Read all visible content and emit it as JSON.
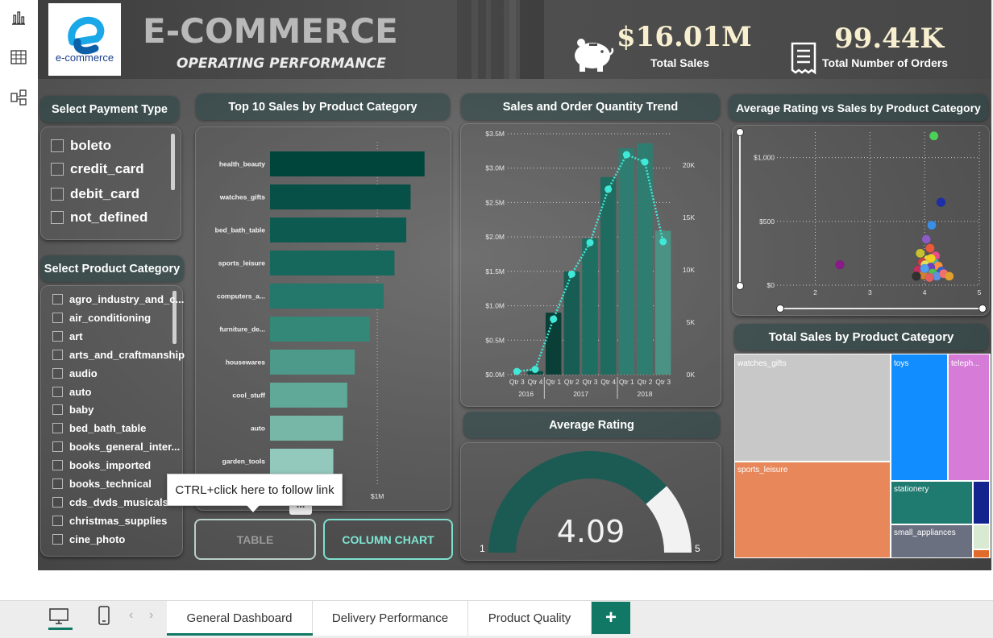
{
  "header": {
    "logo_text": "e-commerce",
    "title": "E-COMMERCE",
    "subtitle": "OPERATING PERFORMANCE",
    "kpis": [
      {
        "value": "$16.01M",
        "label": "Total Sales",
        "icon": "piggy-bank-icon"
      },
      {
        "value": "99.44K",
        "label": "Total Number of Orders",
        "icon": "receipt-icon"
      }
    ]
  },
  "payment_slicer": {
    "title": "Select Payment Type",
    "items": [
      "boleto",
      "credit_card",
      "debit_card",
      "not_defined"
    ]
  },
  "category_slicer": {
    "title": "Select Product Category",
    "items": [
      "agro_industry_and_c...",
      "air_conditioning",
      "art",
      "arts_and_craftmanship",
      "audio",
      "auto",
      "baby",
      "bed_bath_table",
      "books_general_inter...",
      "books_imported",
      "books_technical",
      "cds_dvds_musicals",
      "christmas_supplies",
      "cine_photo"
    ]
  },
  "top10": {
    "title": "Top 10 Sales by Product Category",
    "axis_tick": "$1M",
    "more_glyph": "...",
    "colors": [
      "#00453c",
      "#065047",
      "#0d5a50",
      "#16675c",
      "#24786b",
      "#338878",
      "#4d9a8a",
      "#60a998",
      "#76b7a8",
      "#93c9bd"
    ]
  },
  "trend": {
    "title": "Sales and Order Quantity Trend",
    "years": [
      "2016",
      "2017",
      "2018"
    ],
    "line_color": "#40e8d8",
    "bar_colors": [
      "#0a4c43",
      "#1f6b60",
      "#2f7d70",
      "#4a9284"
    ]
  },
  "scatter": {
    "title": "Average Rating vs Sales by Product Category"
  },
  "gauge": {
    "title": "Average Rating",
    "value": "4.09",
    "min_label": "1",
    "max_label": "5",
    "fraction": 0.7725
  },
  "treemap": {
    "title": "Total Sales by Product Category",
    "tiles": [
      {
        "label": "watches_gifts",
        "color": "#c8c8c8"
      },
      {
        "label": "toys",
        "color": "#118dff"
      },
      {
        "label": "teleph...",
        "color": "#d77bd8"
      },
      {
        "label": "sports_leisure",
        "color": "#e8875a"
      },
      {
        "label": "stationery",
        "color": "#1f7a70"
      },
      {
        "label": "",
        "color": "#13248f"
      },
      {
        "label": "small_appliances",
        "color": "#6b7080"
      },
      {
        "label": "",
        "color": "#d9ead3"
      },
      {
        "label": "",
        "color": "#e06b2a"
      }
    ]
  },
  "tooltip": {
    "text": "CTRL+click here to follow link"
  },
  "buttons": {
    "table": "TABLE",
    "column_chart": "COLUMN CHART"
  },
  "tabs": [
    "General Dashboard",
    "Delivery Performance",
    "Product Quality"
  ],
  "add_tab_glyph": "+",
  "nav_glyphs": {
    "prev": "‹",
    "next": "›"
  },
  "chart_data": [
    {
      "type": "bar",
      "title": "Top 10 Sales by Product Category",
      "orientation": "horizontal",
      "categories": [
        "health_beauty",
        "watches_gifts",
        "bed_bath_table",
        "sports_leisure",
        "computers_a...",
        "furniture_de...",
        "housewares",
        "cool_stuff",
        "auto",
        "garden_tools"
      ],
      "values": [
        1.44,
        1.31,
        1.27,
        1.16,
        1.06,
        0.93,
        0.79,
        0.72,
        0.68,
        0.59
      ],
      "xlabel": "",
      "ylabel": "",
      "x_ticks": [
        "$1M"
      ],
      "xlim": [
        0,
        1.6
      ]
    },
    {
      "type": "bar",
      "title": "Sales and Order Quantity Trend",
      "categories": [
        "Qtr 3",
        "Qtr 4",
        "Qtr 1",
        "Qtr 2",
        "Qtr 3",
        "Qtr 4",
        "Qtr 1",
        "Qtr 2",
        "Qtr 3"
      ],
      "category_groups": [
        "2016",
        "2016",
        "2017",
        "2017",
        "2017",
        "2017",
        "2018",
        "2018",
        "2018"
      ],
      "series": [
        {
          "name": "Sales",
          "type": "bar",
          "axis": "left",
          "values": [
            0.0,
            0.05,
            0.9,
            1.5,
            1.98,
            2.87,
            3.29,
            3.36,
            2.09
          ]
        },
        {
          "name": "Order Quantity",
          "type": "line",
          "axis": "right",
          "values": [
            300,
            500,
            5300,
            9600,
            12600,
            17700,
            21000,
            20300,
            12700
          ]
        }
      ],
      "y_left_ticks": [
        "$0.0M",
        "$0.5M",
        "$1.0M",
        "$1.5M",
        "$2.0M",
        "$2.5M",
        "$3.0M",
        "$3.5M"
      ],
      "y_left_lim": [
        0,
        3.5
      ],
      "y_right_ticks": [
        "0K",
        "5K",
        "10K",
        "15K",
        "20K"
      ],
      "y_right_lim": [
        0,
        23000
      ]
    },
    {
      "type": "scatter",
      "title": "Average Rating vs Sales by Product Category",
      "x_ticks": [
        "2",
        "3",
        "4",
        "5"
      ],
      "y_ticks": [
        "$0",
        "$500",
        "$1,000"
      ],
      "xlim": [
        1.3,
        5
      ],
      "ylim": [
        0,
        1200
      ],
      "points": [
        {
          "x": 2.45,
          "y": 160,
          "color": "#8a1a8a"
        },
        {
          "x": 4.17,
          "y": 1170,
          "color": "#4cd05a"
        },
        {
          "x": 4.3,
          "y": 650,
          "color": "#1c2fa8"
        },
        {
          "x": 4.13,
          "y": 470,
          "color": "#3a8ee8"
        },
        {
          "x": 4.03,
          "y": 360,
          "color": "#8b5cc4"
        },
        {
          "x": 4.1,
          "y": 290,
          "color": "#e85a3a"
        },
        {
          "x": 3.92,
          "y": 250,
          "color": "#c9c030"
        },
        {
          "x": 4.2,
          "y": 230,
          "color": "#e84a8a"
        },
        {
          "x": 4.06,
          "y": 200,
          "color": "#f0e040"
        },
        {
          "x": 3.96,
          "y": 180,
          "color": "#d04040"
        },
        {
          "x": 4.18,
          "y": 175,
          "color": "#40b0b0"
        },
        {
          "x": 4.01,
          "y": 160,
          "color": "#e0e060"
        },
        {
          "x": 4.25,
          "y": 150,
          "color": "#ff9040"
        },
        {
          "x": 4.11,
          "y": 140,
          "color": "#7040c0"
        },
        {
          "x": 3.88,
          "y": 120,
          "color": "#c03060"
        },
        {
          "x": 4.31,
          "y": 110,
          "color": "#3060d0"
        },
        {
          "x": 4.05,
          "y": 100,
          "color": "#a050a0"
        },
        {
          "x": 4.15,
          "y": 95,
          "color": "#50c050"
        },
        {
          "x": 3.98,
          "y": 80,
          "color": "#d08030"
        },
        {
          "x": 4.22,
          "y": 70,
          "color": "#6090e0"
        },
        {
          "x": 4.09,
          "y": 60,
          "color": "#e06060"
        },
        {
          "x": 4.35,
          "y": 90,
          "color": "#f07070"
        },
        {
          "x": 4.45,
          "y": 70,
          "color": "#e0a030"
        },
        {
          "x": 3.85,
          "y": 70,
          "color": "#303030"
        },
        {
          "x": 4.12,
          "y": 210,
          "color": "#f0d020"
        },
        {
          "x": 4.0,
          "y": 130,
          "color": "#50a0f0"
        }
      ]
    },
    {
      "type": "treemap",
      "title": "Total Sales by Product Category",
      "categories": [
        "watches_gifts",
        "sports_leisure",
        "toys",
        "teleph...",
        "stationery",
        "small_appliances"
      ]
    }
  ]
}
